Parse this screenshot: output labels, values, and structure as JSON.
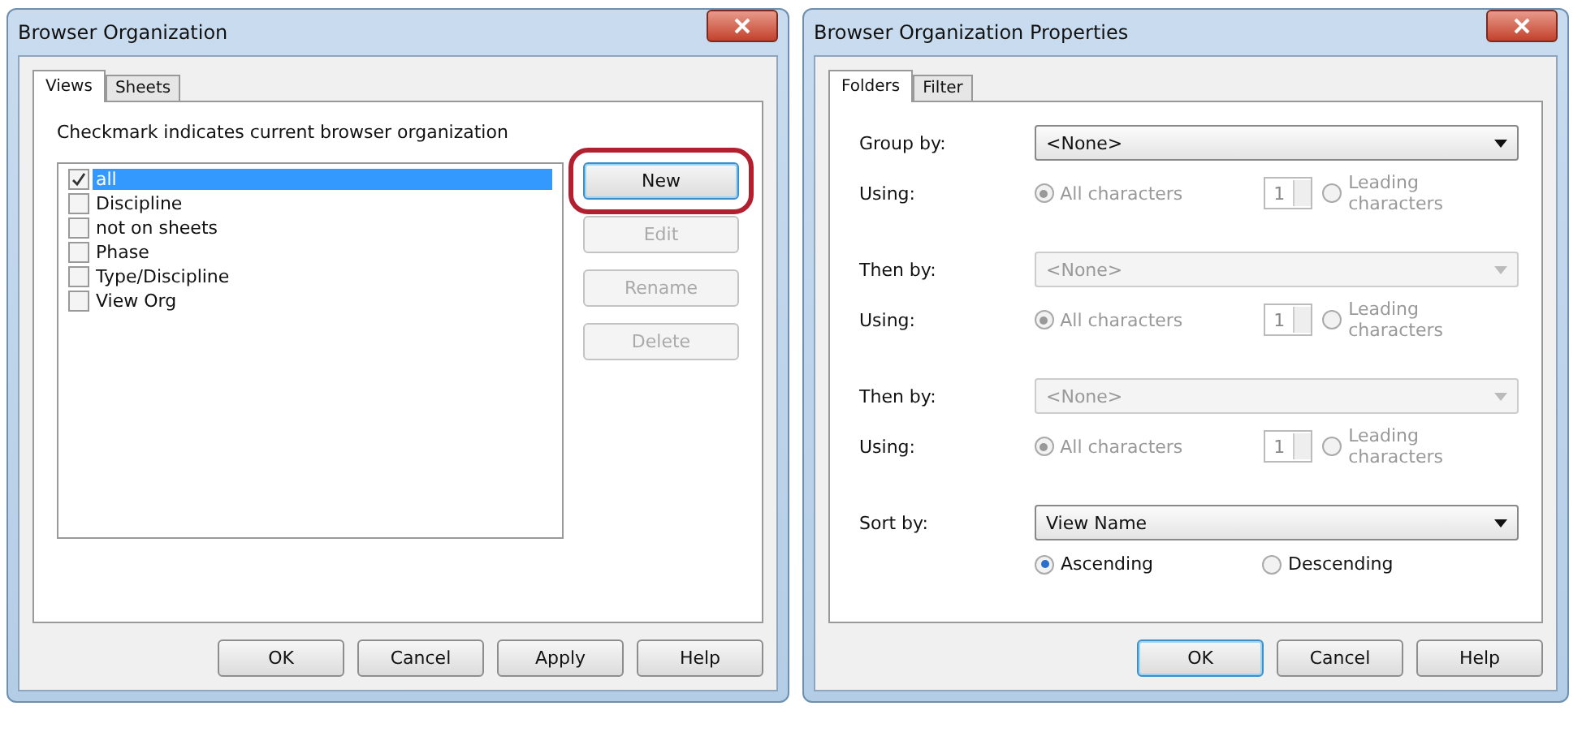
{
  "left_dialog": {
    "title": "Browser Organization",
    "tabs": [
      {
        "label": "Views",
        "selected": true
      },
      {
        "label": "Sheets",
        "selected": false
      }
    ],
    "instruction": "Checkmark indicates current browser organization",
    "items": [
      {
        "label": "all",
        "checked": true,
        "selected": true
      },
      {
        "label": "Discipline",
        "checked": false,
        "selected": false
      },
      {
        "label": "not on sheets",
        "checked": false,
        "selected": false
      },
      {
        "label": "Phase",
        "checked": false,
        "selected": false
      },
      {
        "label": "Type/Discipline",
        "checked": false,
        "selected": false
      },
      {
        "label": "View Org",
        "checked": false,
        "selected": false
      }
    ],
    "side_buttons": [
      {
        "label": "New",
        "disabled": false,
        "circled": true
      },
      {
        "label": "Edit",
        "disabled": true,
        "circled": false
      },
      {
        "label": "Rename",
        "disabled": true,
        "circled": false
      },
      {
        "label": "Delete",
        "disabled": true,
        "circled": false
      }
    ],
    "buttons": [
      {
        "label": "OK",
        "default": false
      },
      {
        "label": "Cancel",
        "default": false
      },
      {
        "label": "Apply",
        "default": false
      },
      {
        "label": "Help",
        "default": false
      }
    ]
  },
  "right_dialog": {
    "title": "Browser Organization Properties",
    "tabs": [
      {
        "label": "Folders",
        "selected": true
      },
      {
        "label": "Filter",
        "selected": false
      }
    ],
    "groups": [
      {
        "label": "Group by:",
        "value": "<None>",
        "disabled": false,
        "using_label": "Using:",
        "options": [
          {
            "label": "All characters",
            "selected": true
          },
          {
            "label": "Leading characters",
            "selected": false
          }
        ],
        "count": "1"
      },
      {
        "label": "Then by:",
        "value": "<None>",
        "disabled": true,
        "using_label": "Using:",
        "options": [
          {
            "label": "All characters",
            "selected": true
          },
          {
            "label": "Leading characters",
            "selected": false
          }
        ],
        "count": "1"
      },
      {
        "label": "Then by:",
        "value": "<None>",
        "disabled": true,
        "using_label": "Using:",
        "options": [
          {
            "label": "All characters",
            "selected": true
          },
          {
            "label": "Leading characters",
            "selected": false
          }
        ],
        "count": "1"
      }
    ],
    "sort": {
      "label": "Sort by:",
      "value": "View Name",
      "disabled": false
    },
    "order": [
      {
        "label": "Ascending",
        "selected": true
      },
      {
        "label": "Descending",
        "selected": false
      }
    ],
    "buttons": [
      {
        "label": "OK",
        "default": true
      },
      {
        "label": "Cancel",
        "default": false
      },
      {
        "label": "Help",
        "default": false
      }
    ]
  }
}
